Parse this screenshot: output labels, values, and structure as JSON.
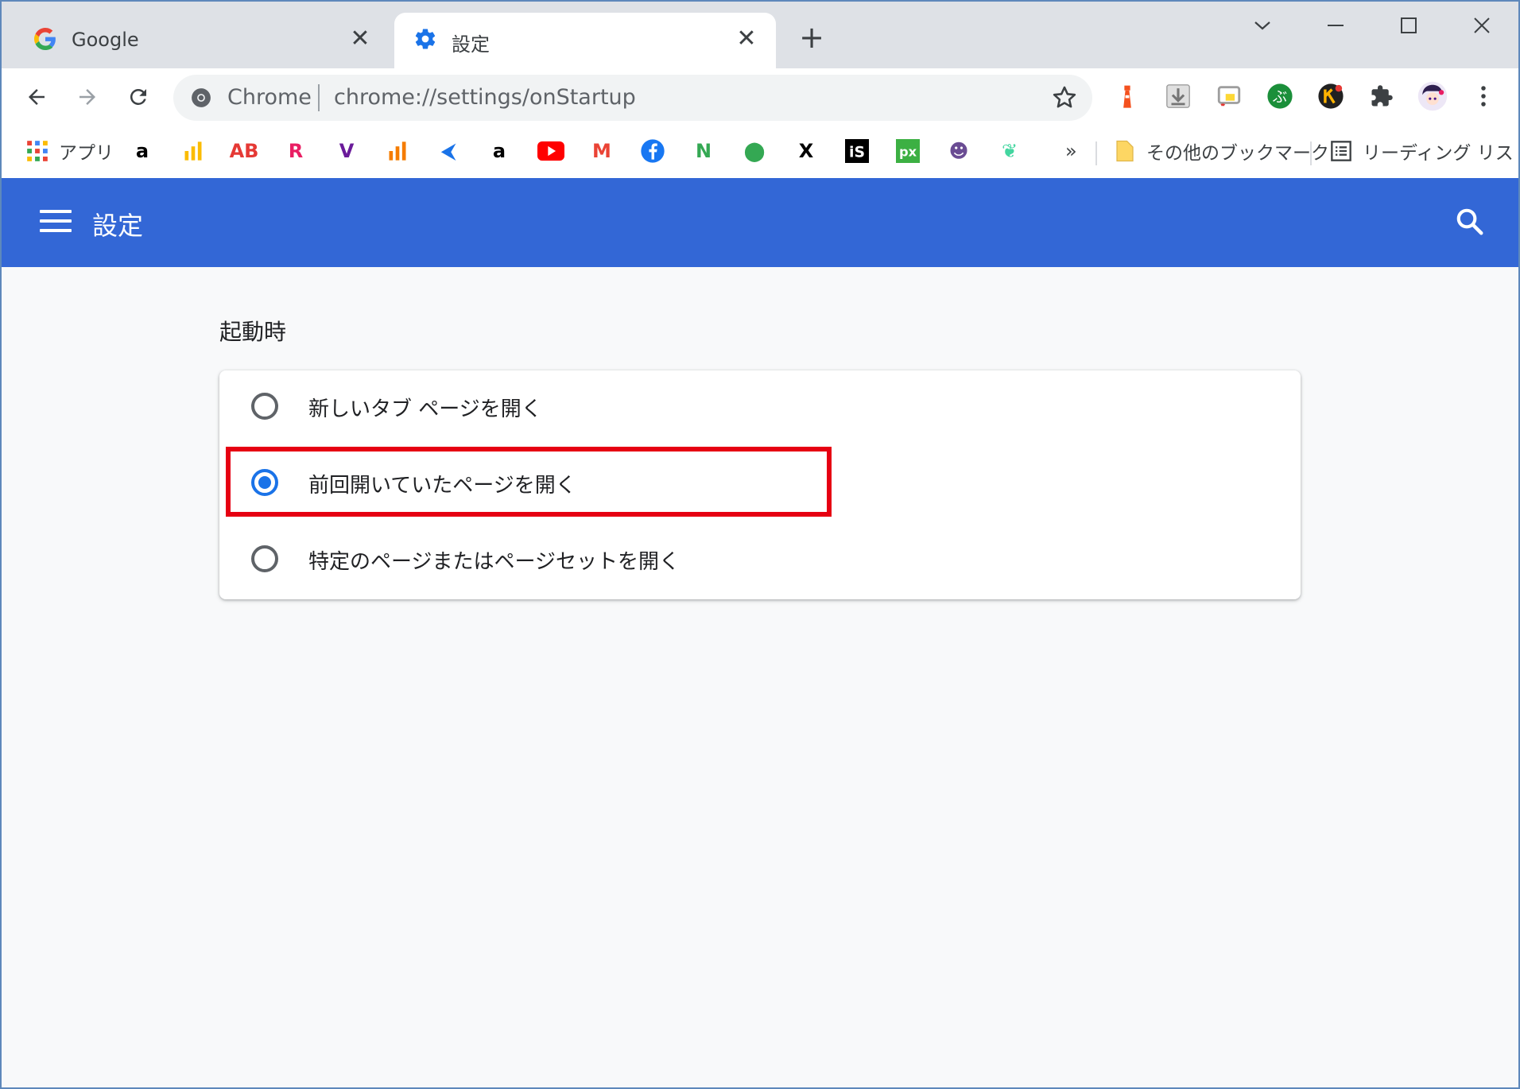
{
  "tabs": [
    {
      "title": "Google",
      "icon": "google-g-icon",
      "active": false
    },
    {
      "title": "設定",
      "icon": "gear-icon",
      "active": true
    }
  ],
  "omnibox": {
    "chip": "Chrome",
    "url": "chrome://settings/onStartup"
  },
  "bookmarks": {
    "apps_label": "アプリ",
    "other_bookmarks": "その他のブックマーク",
    "reading_list": "リーディング リスト",
    "overflow": "»",
    "items": [
      {
        "icon": "amazon-icon",
        "glyph": "a",
        "color": "#000000"
      },
      {
        "icon": "google-ads-icon",
        "glyph": "",
        "color": "#fbbc04"
      },
      {
        "icon": "ab-icon",
        "glyph": "AB",
        "color": "#e53935"
      },
      {
        "icon": "rakuten-icon",
        "glyph": "R",
        "color": "#e91e63"
      },
      {
        "icon": "vectorworks-icon",
        "glyph": "V",
        "color": "#6a1b9a"
      },
      {
        "icon": "analytics-icon",
        "glyph": "",
        "color": "#f57c00"
      },
      {
        "icon": "arrow-app-icon",
        "glyph": "⮜",
        "color": "#1a73e8"
      },
      {
        "icon": "amazon-icon",
        "glyph": "a",
        "color": "#000000"
      },
      {
        "icon": "youtube-icon",
        "glyph": "▶",
        "color": "#ff0000"
      },
      {
        "icon": "gmail-icon",
        "glyph": "M",
        "color": "#ea4335"
      },
      {
        "icon": "facebook-icon",
        "glyph": "f",
        "color": "#1877f2"
      },
      {
        "icon": "colorful-app-icon",
        "glyph": "N",
        "color": "#34a853"
      },
      {
        "icon": "google-maps-icon",
        "glyph": "⬤",
        "color": "#34a853"
      },
      {
        "icon": "x-icon",
        "glyph": "X",
        "color": "#000000"
      },
      {
        "icon": "is-icon",
        "glyph": "iS",
        "color": "#000000"
      },
      {
        "icon": "pixiv-icon",
        "glyph": "px",
        "color": "#3cb043"
      },
      {
        "icon": "character-avatar-icon",
        "glyph": "☻",
        "color": "#6a4c93"
      },
      {
        "icon": "green-leaf-icon",
        "glyph": "❦",
        "color": "#43d6a0"
      }
    ]
  },
  "settings": {
    "header_title": "設定",
    "section_title": "起動時",
    "options": [
      {
        "label": "新しいタブ ページを開く",
        "checked": false
      },
      {
        "label": "前回開いていたページを開く",
        "checked": true
      },
      {
        "label": "特定のページまたはページセットを開く",
        "checked": false
      }
    ]
  },
  "colors": {
    "header_blue": "#3367d6",
    "radio_selected": "#1a73e8",
    "highlight_red": "#e60012"
  }
}
